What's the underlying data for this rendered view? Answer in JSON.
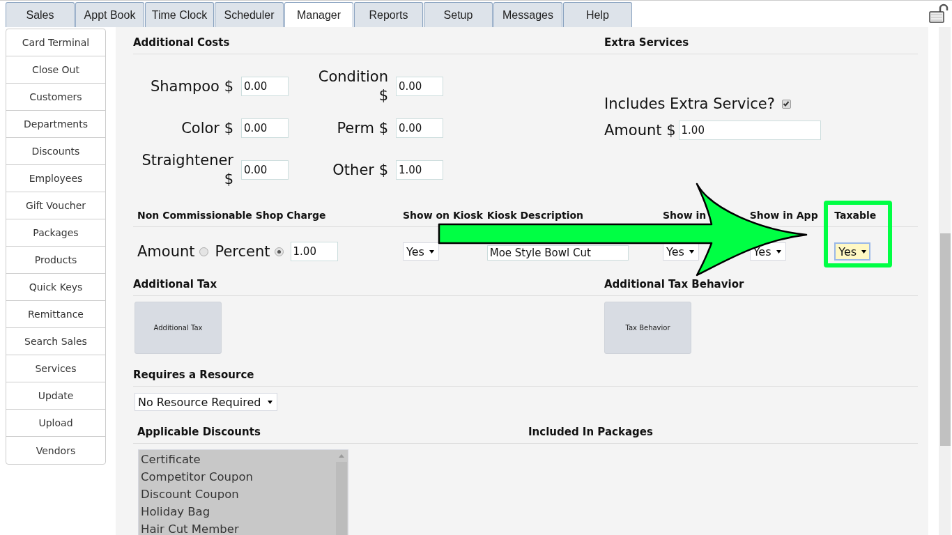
{
  "tabs": [
    {
      "label": "Sales",
      "selected": false
    },
    {
      "label": "Appt Book",
      "selected": false
    },
    {
      "label": "Time Clock",
      "selected": false
    },
    {
      "label": "Scheduler",
      "selected": false
    },
    {
      "label": "Manager",
      "selected": true
    },
    {
      "label": "Reports",
      "selected": false
    },
    {
      "label": "Setup",
      "selected": false
    },
    {
      "label": "Messages",
      "selected": false
    },
    {
      "label": "Help",
      "selected": false
    }
  ],
  "sidebar": {
    "items": [
      "Card Terminal",
      "Close Out",
      "Customers",
      "Departments",
      "Discounts",
      "Employees",
      "Gift Voucher",
      "Packages",
      "Products",
      "Quick Keys",
      "Remittance",
      "Search Sales",
      "Services",
      "Update",
      "Upload",
      "Vendors"
    ]
  },
  "additional_costs": {
    "title": "Additional Costs",
    "fields": [
      {
        "label": "Shampoo $",
        "value": "0.00"
      },
      {
        "label": "Color $",
        "value": "0.00"
      },
      {
        "label": "Straightener $",
        "value": "0.00"
      },
      {
        "label": "Condition $",
        "value": "0.00"
      },
      {
        "label": "Perm $",
        "value": "0.00"
      },
      {
        "label": "Other $",
        "value": "1.00"
      }
    ]
  },
  "extra_services": {
    "title": "Extra Services",
    "includes_label": "Includes Extra Service?",
    "checked": true,
    "amount_label": "Amount $",
    "amount_value": "1.00"
  },
  "shop_charge": {
    "columns": [
      "Non Commissionable Shop Charge",
      "Show on Kiosk",
      "Kiosk Description",
      "Show in",
      "Show in App",
      "Taxable"
    ],
    "options": [
      {
        "label": "Amount",
        "selected": false
      },
      {
        "label": "Percent",
        "selected": true
      }
    ],
    "value": "1.00",
    "show_on_kiosk": "Yes",
    "kiosk_description": "Moe Style Bowl Cut",
    "show_in": "Yes",
    "show_in_app": "Yes",
    "taxable": {
      "value": "Yes",
      "focused": true
    }
  },
  "additional_tax": {
    "title": "Additional Tax",
    "button": "Additional Tax"
  },
  "tax_behavior": {
    "title": "Additional Tax Behavior",
    "button": "Tax Behavior"
  },
  "resource": {
    "title": "Requires a Resource",
    "value": "No Resource Required"
  },
  "discounts": {
    "title": "Applicable Discounts",
    "items": [
      "Certificate",
      "Competitor Coupon",
      "Discount Coupon",
      "Holiday Bag",
      "Hair Cut Member"
    ]
  },
  "packages": {
    "title": "Included In Packages"
  }
}
